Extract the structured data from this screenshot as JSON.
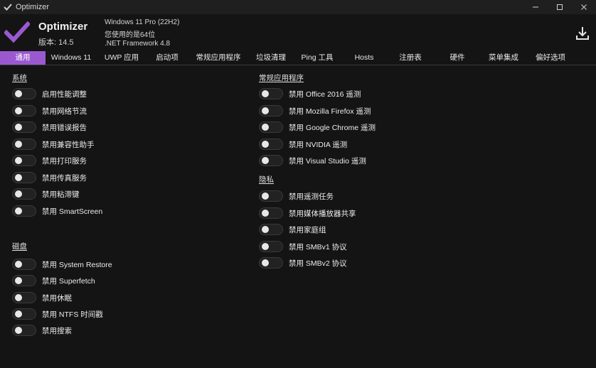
{
  "window": {
    "title": "Optimizer"
  },
  "header": {
    "app_name": "Optimizer",
    "version": "版本: 14.5",
    "os": "Windows 11 Pro (22H2)",
    "arch": "您使用的是64位",
    "framework": ".NET Framework 4.8"
  },
  "colors": {
    "accent": "#9b59d0",
    "background": "#141414"
  },
  "tabs": [
    {
      "label": "通用"
    },
    {
      "label": "Windows 11"
    },
    {
      "label": "UWP 应用"
    },
    {
      "label": "启动项"
    },
    {
      "label": "常规应用程序"
    },
    {
      "label": "垃圾清理"
    },
    {
      "label": "Ping 工具"
    },
    {
      "label": "Hosts"
    },
    {
      "label": "注册表"
    },
    {
      "label": "硬件"
    },
    {
      "label": "菜单集成"
    },
    {
      "label": "偏好选项"
    }
  ],
  "sections": {
    "system": {
      "title": "系统",
      "items": [
        {
          "label": "启用性能调整",
          "on": false
        },
        {
          "label": "禁用网络节流",
          "on": false
        },
        {
          "label": "禁用错误报告",
          "on": false
        },
        {
          "label": "禁用兼容性助手",
          "on": false
        },
        {
          "label": "禁用打印服务",
          "on": false
        },
        {
          "label": "禁用传真服务",
          "on": false
        },
        {
          "label": "禁用粘滞键",
          "on": false
        },
        {
          "label": "禁用 SmartScreen",
          "on": false
        }
      ]
    },
    "disk": {
      "title": "磁盘",
      "items": [
        {
          "label": "禁用 System Restore",
          "on": false
        },
        {
          "label": "禁用 Superfetch",
          "on": false
        },
        {
          "label": "禁用休眠",
          "on": false
        },
        {
          "label": "禁用 NTFS 时间戳",
          "on": false
        },
        {
          "label": "禁用搜索",
          "on": false
        }
      ]
    },
    "apps": {
      "title": "常规应用程序",
      "items": [
        {
          "label": "禁用 Office 2016 遥测",
          "on": false
        },
        {
          "label": "禁用 Mozilla Firefox 遥测",
          "on": false
        },
        {
          "label": "禁用 Google Chrome 遥测",
          "on": false
        },
        {
          "label": "禁用 NVIDIA 遥测",
          "on": false
        },
        {
          "label": "禁用 Visual Studio 遥测",
          "on": false
        }
      ]
    },
    "privacy": {
      "title": "隐私",
      "items": [
        {
          "label": "禁用遥测任务",
          "on": false
        },
        {
          "label": "禁用媒体播放器共享",
          "on": false
        },
        {
          "label": "禁用家庭组",
          "on": false
        },
        {
          "label": "禁用 SMBv1 协议",
          "on": false
        },
        {
          "label": "禁用 SMBv2 协议",
          "on": false
        }
      ]
    }
  }
}
